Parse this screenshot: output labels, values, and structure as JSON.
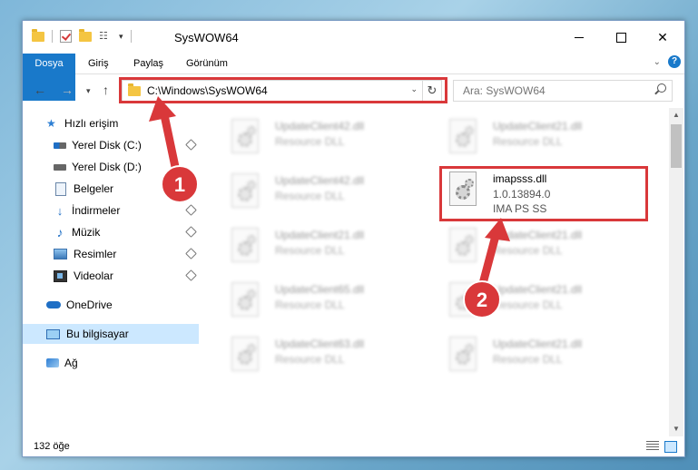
{
  "window": {
    "title": "SysWOW64"
  },
  "ribbon": {
    "tabs": [
      "Dosya",
      "Giriş",
      "Paylaş",
      "Görünüm"
    ],
    "help": "?"
  },
  "address": {
    "path": "C:\\Windows\\SysWOW64",
    "search_placeholder": "Ara: SysWOW64"
  },
  "nav": {
    "items": [
      {
        "label": "Hızlı erişim"
      },
      {
        "label": "Yerel Disk (C:)"
      },
      {
        "label": "Yerel Disk (D:)"
      },
      {
        "label": "Belgeler"
      },
      {
        "label": "İndirmeler"
      },
      {
        "label": "Müzik"
      },
      {
        "label": "Resimler"
      },
      {
        "label": "Videolar"
      },
      {
        "label": "OneDrive"
      },
      {
        "label": "Bu bilgisayar"
      },
      {
        "label": "Ağ"
      }
    ]
  },
  "files": {
    "col1": [
      {
        "name": "UpdateClient42.dll",
        "desc": "Resource DLL"
      },
      {
        "name": "UpdateClient42.dll",
        "desc": "Resource DLL"
      },
      {
        "name": "UpdateClient21.dll",
        "desc": "Resource DLL"
      },
      {
        "name": "UpdateClient65.dll",
        "desc": "Resource DLL"
      },
      {
        "name": "UpdateClient63.dll",
        "desc": "Resource DLL"
      }
    ],
    "col2": [
      {
        "name": "UpdateClient21.dll",
        "desc": "Resource DLL"
      },
      {
        "name": "UpdateClient21.dll",
        "desc": "Resource DLL"
      },
      {
        "name": "UpdateClient21.dll",
        "desc": "Resource DLL"
      },
      {
        "name": "UpdateClient21.dll",
        "desc": "Resource DLL"
      }
    ],
    "highlighted": {
      "name": "imapsss.dll",
      "version": "1.0.13894.0",
      "desc": "IMA PS SS"
    }
  },
  "status": {
    "count": "132 öğe"
  },
  "annotations": {
    "badge1": "1",
    "badge2": "2",
    "color": "#d9383a"
  }
}
